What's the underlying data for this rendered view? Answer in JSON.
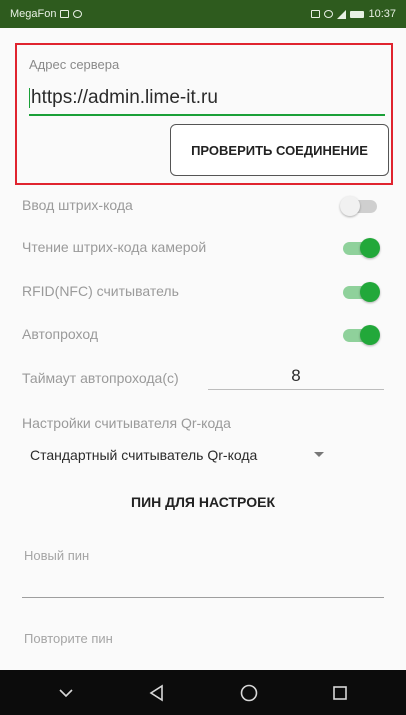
{
  "status_bar": {
    "carrier": "MegaFon",
    "time": "10:37",
    "icons": [
      "sim-icon",
      "whatsapp-icon",
      "nfc-icon",
      "alarm-icon",
      "signal-icon",
      "battery-icon"
    ]
  },
  "server": {
    "label": "Адрес сервера",
    "value": "https://admin.lime-it.ru",
    "check_button_label": "ПРОВЕРИТЬ СОЕДИНЕНИЕ"
  },
  "settings": [
    {
      "label": "Ввод штрих-кода",
      "enabled": false
    },
    {
      "label": "Чтение штрих-кода камерой",
      "enabled": true
    },
    {
      "label": "RFID(NFC) считыватель",
      "enabled": true
    },
    {
      "label": "Автопроход",
      "enabled": true
    }
  ],
  "timeout": {
    "label": "Таймаут автопрохода(с)",
    "value": "8"
  },
  "qr": {
    "label": "Настройки считывателя Qr-кода",
    "selected": "Стандартный считыватель Qr-кода"
  },
  "pin": {
    "title": "ПИН ДЛЯ НАСТРОЕК",
    "new_placeholder": "Новый пин",
    "repeat_placeholder": "Повторите пин"
  },
  "colors": {
    "accent_green": "#22a83a",
    "highlight_red": "#e0242f",
    "status_bar_bg": "#2e5b1e"
  },
  "nav_icons": [
    "collapse-icon",
    "back-icon",
    "home-icon",
    "recents-icon"
  ]
}
